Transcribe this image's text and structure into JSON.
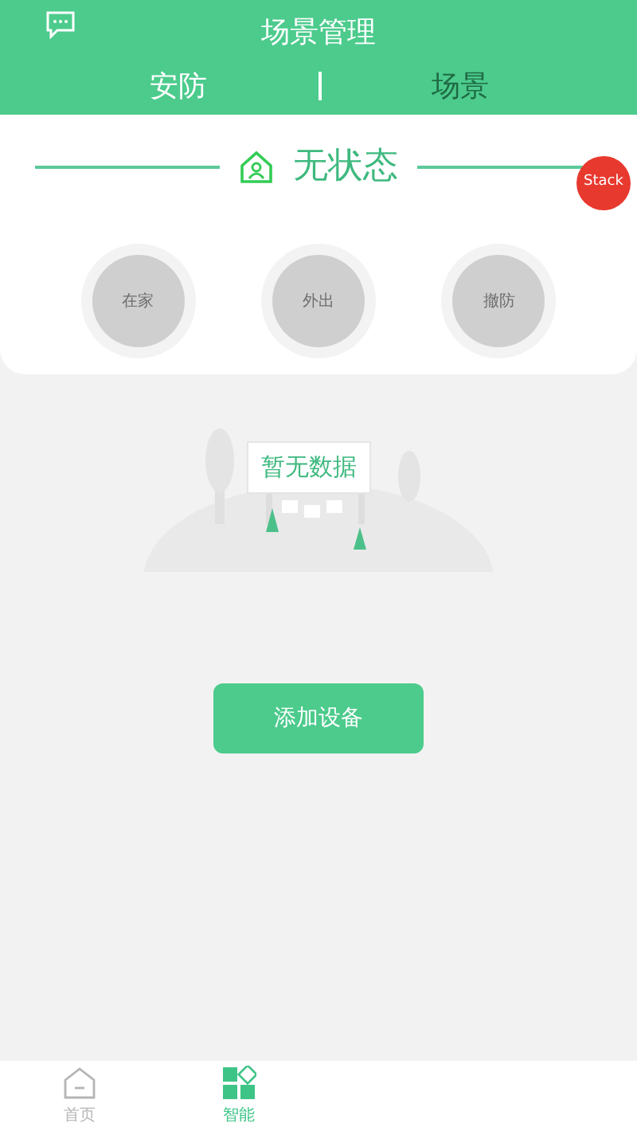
{
  "header": {
    "title": "场景管理"
  },
  "tabs": [
    {
      "label": "安防",
      "selected": true
    },
    {
      "label": "场景",
      "selected": false
    }
  ],
  "status": {
    "label": "无状态"
  },
  "badge": "Stack",
  "modes": [
    {
      "label": "在家"
    },
    {
      "label": "外出"
    },
    {
      "label": "撤防"
    }
  ],
  "empty": {
    "label": "暂无数据"
  },
  "add_button": "添加设备",
  "nav": [
    {
      "label": "首页",
      "kind": "home",
      "selected": false
    },
    {
      "label": "智能",
      "kind": "smart",
      "selected": true
    }
  ]
}
